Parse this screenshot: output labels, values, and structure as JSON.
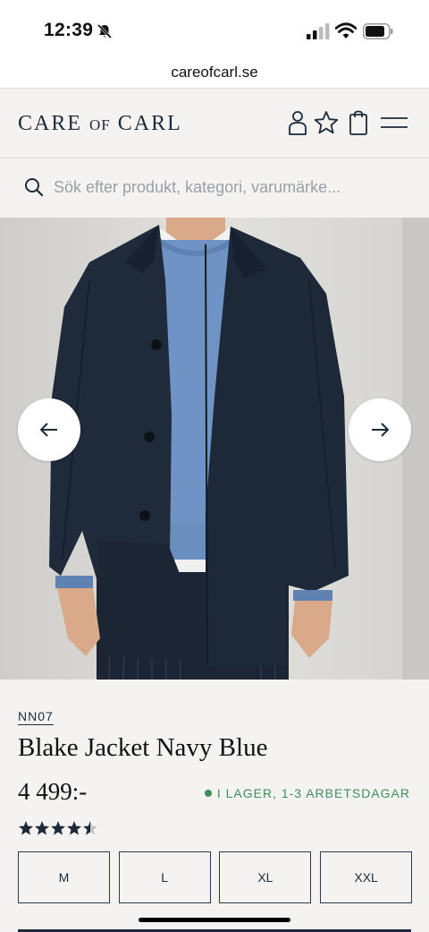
{
  "status": {
    "time": "12:39"
  },
  "browser": {
    "url": "careofcarl.se"
  },
  "header": {
    "logo_main_1": "CARE",
    "logo_of": "OF",
    "logo_main_2": "CARL"
  },
  "search": {
    "placeholder": "Sök efter produkt, kategori, varumärke..."
  },
  "product": {
    "brand": "NN07",
    "title": "Blake Jacket Navy Blue",
    "price": "4 499:-",
    "stock_text": "I LAGER, 1-3 ARBETSDAGAR",
    "rating": 4.5,
    "rating_max": 5,
    "sizes": [
      "M",
      "L",
      "XL",
      "XXL"
    ]
  },
  "colors": {
    "navy": "#1c2a3a",
    "stock_green": "#3f8f5a",
    "background": "#f4f3f1"
  },
  "icons": {
    "header": [
      "user-icon",
      "star-icon",
      "bag-icon",
      "menu-icon"
    ],
    "search": "search-icon",
    "carousel": [
      "arrow-left-icon",
      "arrow-right-icon"
    ]
  }
}
